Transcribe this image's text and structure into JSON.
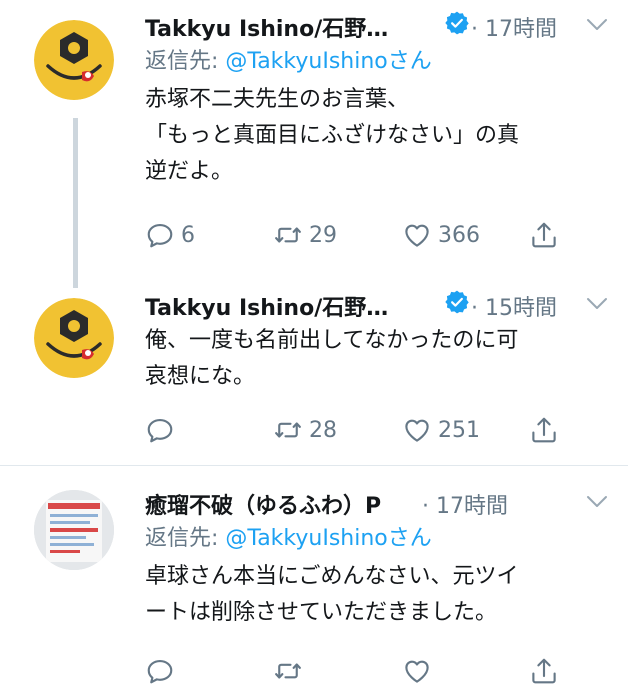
{
  "tweets": [
    {
      "name": "Takkyu Ishino/石野…",
      "meta": "· 17時間",
      "reply_prefix": "返信先: ",
      "reply_handle": "@TakkyuIshinoさん",
      "text": [
        "赤塚不二夫先生のお言葉、",
        "「もっと真面目にふざけなさい」の真",
        "逆だよ。"
      ],
      "replies": "6",
      "retweets": "29",
      "likes": "366"
    },
    {
      "name": "Takkyu Ishino/石野…",
      "meta": "· 15時間",
      "text": [
        "俺、一度も名前出してなかったのに可",
        "哀想にな。"
      ],
      "replies": "",
      "retweets": "28",
      "likes": "251"
    },
    {
      "name": "癒瑠不破（ゆるふわ）P",
      "meta": "· 17時間",
      "reply_prefix": "返信先: ",
      "reply_handle": "@TakkyuIshinoさん",
      "text": [
        "卓球さん本当にごめんなさい、元ツイ",
        "ートは削除させていただきました。"
      ],
      "replies": "",
      "retweets": "",
      "likes": ""
    }
  ],
  "colors": {
    "accent": "#1da1f2",
    "secondary_text": "#657786",
    "primary_text": "#14171a",
    "thread_line": "#cdd6dd",
    "avatar_yellow": "#f1c232"
  },
  "icons": [
    "reply-icon",
    "retweet-icon",
    "like-icon",
    "share-icon",
    "verified-badge-icon",
    "caret-down-icon"
  ]
}
